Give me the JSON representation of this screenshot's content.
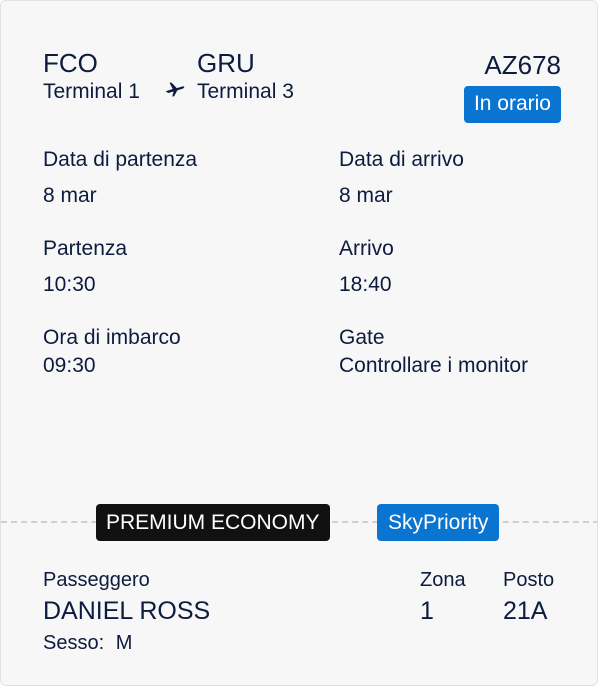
{
  "flight": {
    "origin": {
      "code": "FCO",
      "terminal": "Terminal 1"
    },
    "destination": {
      "code": "GRU",
      "terminal": "Terminal 3"
    },
    "number": "AZ678",
    "status": "In orario",
    "status_color": "#0a74d1"
  },
  "details": {
    "departure_date_label": "Data di partenza",
    "departure_date": "8 mar",
    "arrival_date_label": "Data di arrivo",
    "arrival_date": "8 mar",
    "departure_label": "Partenza",
    "departure_time": "10:30",
    "arrival_label": "Arrivo",
    "arrival_time": "18:40",
    "boarding_label": "Ora di imbarco",
    "boarding_time": "09:30",
    "gate_label": "Gate",
    "gate_value": "Controllare i monitor"
  },
  "badges": {
    "cabin": "PREMIUM ECONOMY",
    "cabin_color": "#111111",
    "priority": "SkyPriority",
    "priority_color": "#0a74d1"
  },
  "passenger": {
    "label": "Passeggero",
    "name": "DANIEL ROSS",
    "sex_label": "Sesso:",
    "sex": "M",
    "zone_label": "Zona",
    "zone": "1",
    "seat_label": "Posto",
    "seat": "21A"
  },
  "icons": {
    "route": "airplane-icon"
  }
}
